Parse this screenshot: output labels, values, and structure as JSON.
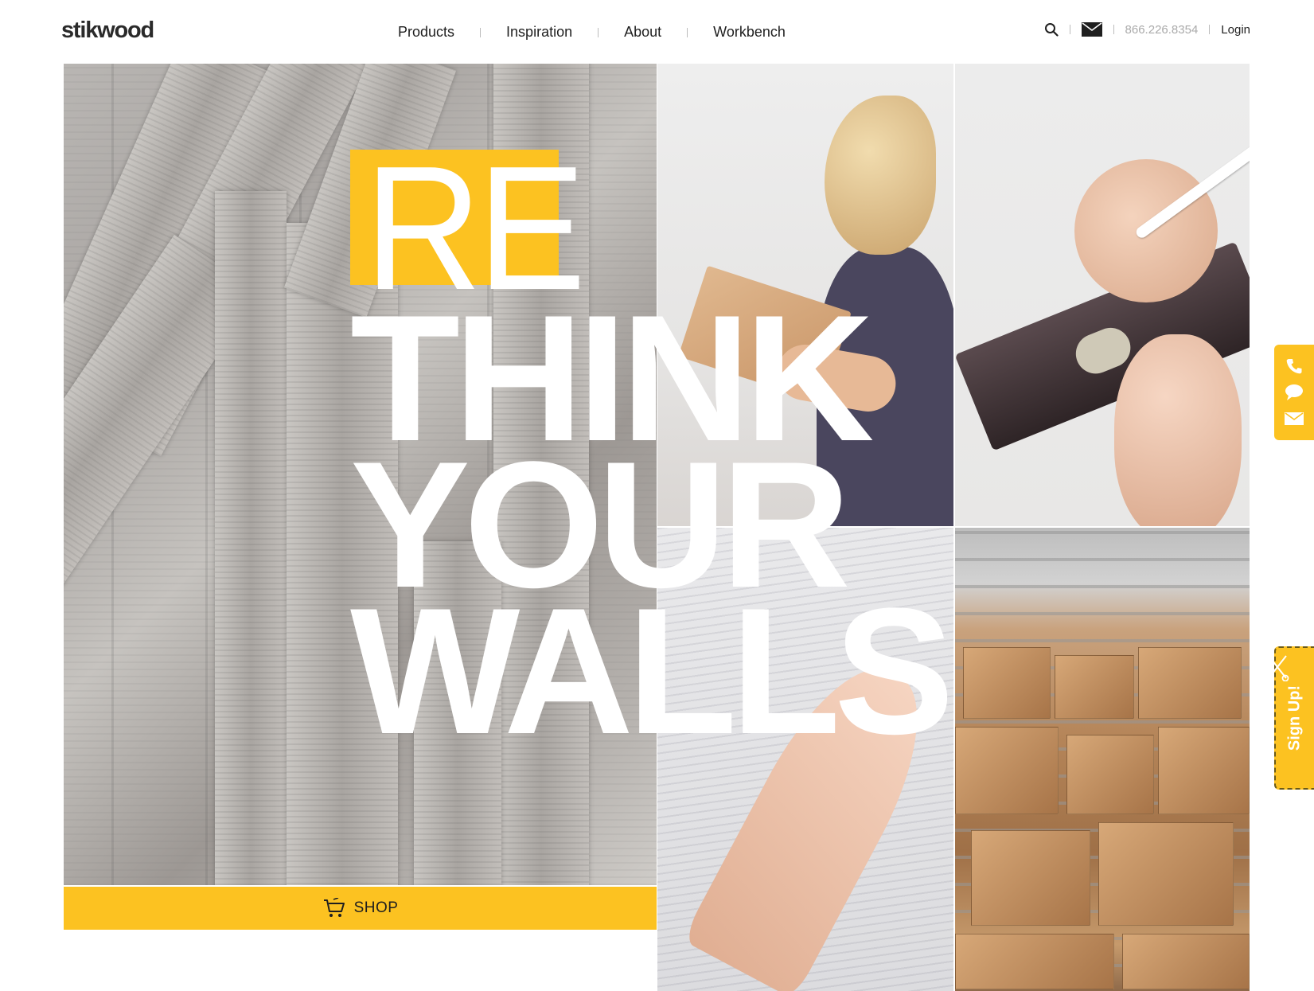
{
  "header": {
    "logo": "stikwood",
    "nav": [
      {
        "label": "Products"
      },
      {
        "label": "Inspiration"
      },
      {
        "label": "About"
      },
      {
        "label": "Workbench"
      }
    ],
    "phone": "866.226.8354",
    "login": "Login",
    "icons": [
      "search-icon",
      "mail-icon"
    ]
  },
  "hero": {
    "headline_prefix": "RE",
    "headline_lines": [
      "THINK",
      "YOUR",
      "WALLS"
    ],
    "shop_label": "SHOP",
    "shop_icon": "cart-icon"
  },
  "side_tabs": {
    "contact_icons": [
      "phone-icon",
      "chat-icon",
      "mail-icon"
    ],
    "signup_label": "Sign Up!",
    "signup_icon": "scissors-icon"
  },
  "colors": {
    "accent_yellow": "#fcc221",
    "text_dark": "#1f1f1f",
    "phone_grey": "#aaaaaa"
  }
}
